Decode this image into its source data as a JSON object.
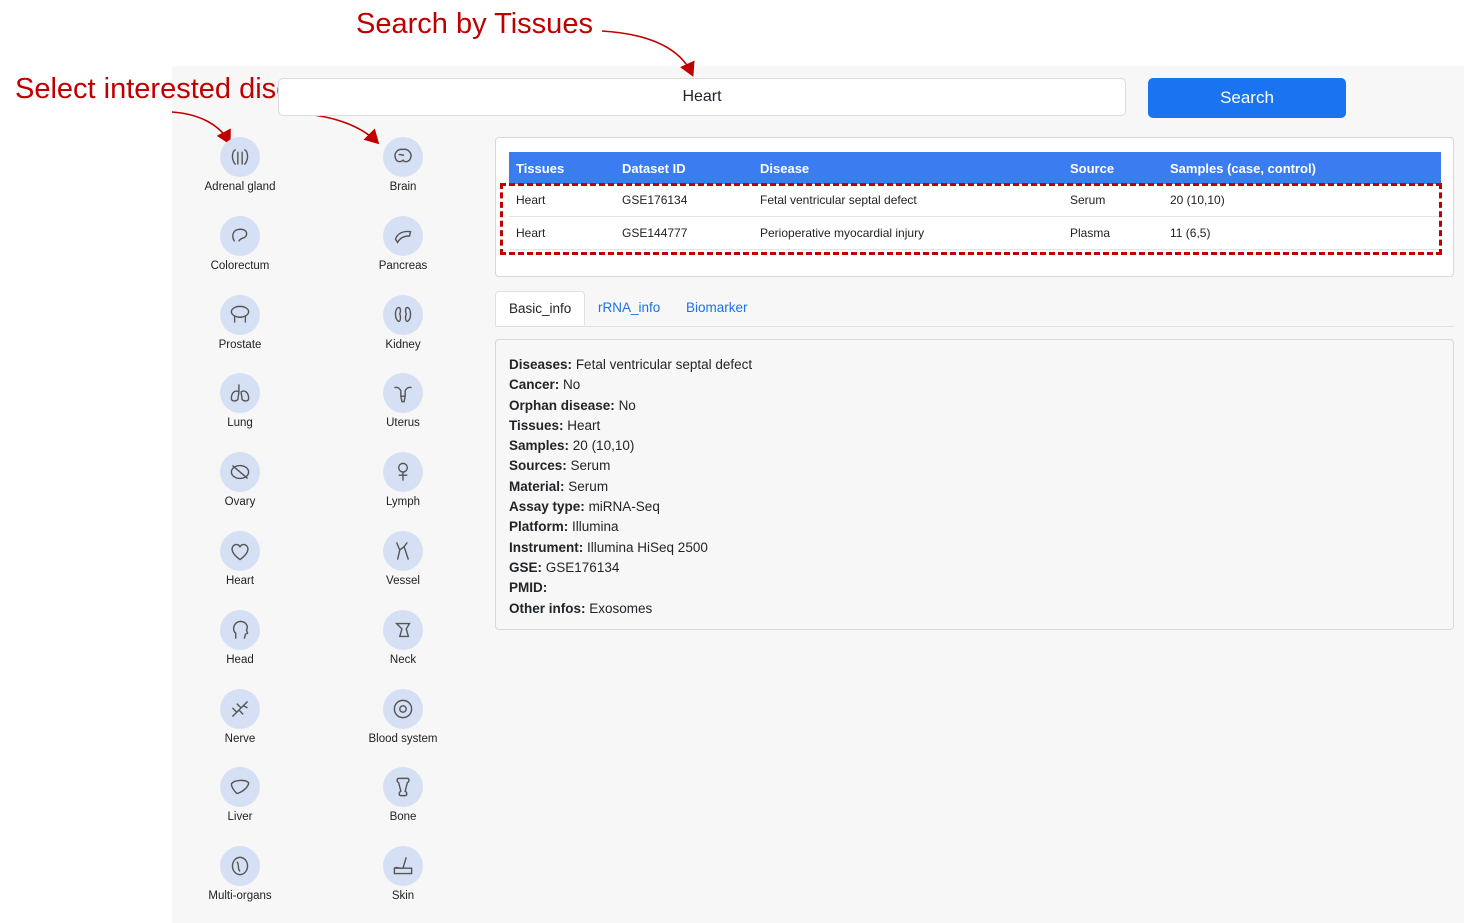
{
  "annotations": {
    "search_by_tissues": "Search by Tissues",
    "select_diseases": "Select interested diseases"
  },
  "search": {
    "value": "Heart",
    "button_label": "Search"
  },
  "organs_left": [
    {
      "label": "Adrenal gland",
      "icon": "adrenal-gland-icon"
    },
    {
      "label": "Colorectum",
      "icon": "colorectum-icon"
    },
    {
      "label": "Prostate",
      "icon": "prostate-icon"
    },
    {
      "label": "Lung",
      "icon": "lung-icon"
    },
    {
      "label": "Ovary",
      "icon": "ovary-icon"
    },
    {
      "label": "Heart",
      "icon": "heart-icon"
    },
    {
      "label": "Head",
      "icon": "head-icon"
    },
    {
      "label": "Nerve",
      "icon": "nerve-icon"
    },
    {
      "label": "Liver",
      "icon": "liver-icon"
    },
    {
      "label": "Multi-organs",
      "icon": "multi-organs-icon"
    }
  ],
  "organs_right": [
    {
      "label": "Brain",
      "icon": "brain-icon"
    },
    {
      "label": "Pancreas",
      "icon": "pancreas-icon"
    },
    {
      "label": "Kidney",
      "icon": "kidney-icon"
    },
    {
      "label": "Uterus",
      "icon": "uterus-icon"
    },
    {
      "label": "Lymph",
      "icon": "lymph-icon"
    },
    {
      "label": "Vessel",
      "icon": "vessel-icon"
    },
    {
      "label": "Neck",
      "icon": "neck-icon"
    },
    {
      "label": "Blood system",
      "icon": "blood-system-icon"
    },
    {
      "label": "Bone",
      "icon": "bone-icon"
    },
    {
      "label": "Skin",
      "icon": "skin-icon"
    }
  ],
  "results": {
    "columns": [
      "Tissues",
      "Dataset ID",
      "Disease",
      "Source",
      "Samples (case, control)"
    ],
    "rows": [
      [
        "Heart",
        "GSE176134",
        "Fetal ventricular septal defect",
        "Serum",
        "20 (10,10)"
      ],
      [
        "Heart",
        "GSE144777",
        "Perioperative myocardial injury",
        "Plasma",
        "11 (6,5)"
      ]
    ]
  },
  "tabs": [
    "Basic_info",
    "rRNA_info",
    "Biomarker"
  ],
  "basic_info": [
    {
      "key": "Diseases:",
      "value": "Fetal ventricular septal defect"
    },
    {
      "key": "Cancer:",
      "value": "No"
    },
    {
      "key": "Orphan disease:",
      "value": "No"
    },
    {
      "key": "Tissues:",
      "value": "Heart"
    },
    {
      "key": "Samples:",
      "value": "20 (10,10)"
    },
    {
      "key": "Sources:",
      "value": "Serum"
    },
    {
      "key": "Material:",
      "value": "Serum"
    },
    {
      "key": "Assay type:",
      "value": "miRNA-Seq"
    },
    {
      "key": "Platform:",
      "value": "Illumina"
    },
    {
      "key": "Instrument:",
      "value": "Illumina HiSeq 2500"
    },
    {
      "key": "GSE:",
      "value": "GSE176134"
    },
    {
      "key": "PMID:",
      "value": ""
    },
    {
      "key": "Other infos:",
      "value": "Exosomes"
    }
  ],
  "colors": {
    "annotation": "#c00000",
    "primary": "#1a73f0",
    "table_header": "#3b7cf0",
    "icon_circle": "#d6e0f5"
  }
}
